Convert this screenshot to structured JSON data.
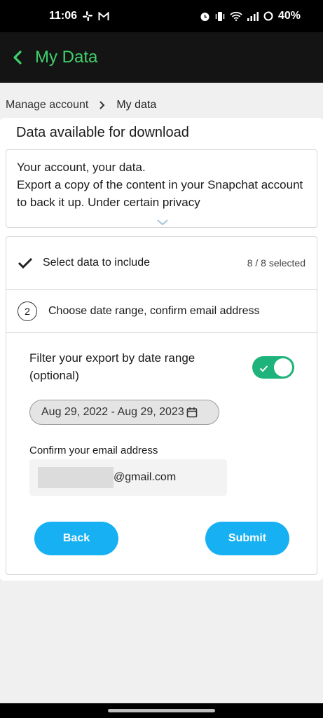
{
  "status_bar": {
    "time": "11:06",
    "battery": "40%",
    "left_icons": [
      "slack-icon",
      "mail-icon"
    ],
    "right_icons": [
      "alarm-icon",
      "vibrate-icon",
      "wifi-icon",
      "signal-icon",
      "battery-icon"
    ]
  },
  "app_bar": {
    "title": "My Data",
    "accent_color": "#3fd06a"
  },
  "breadcrumb": {
    "parent": "Manage account",
    "current": "My data"
  },
  "card": {
    "title": "Data available for download",
    "intro": {
      "line1": "Your account, your data.",
      "line2": "Export a copy of the content in your Snapchat account to back it up. Under certain privacy"
    }
  },
  "steps": {
    "step1": {
      "label": "Select data to include",
      "count": "8 / 8 selected"
    },
    "step2": {
      "number": "2",
      "label": "Choose date range, confirm email address"
    }
  },
  "filter": {
    "label": "Filter your export by date range (optional)",
    "enabled": true,
    "date_range": "Aug 29, 2022 - Aug 29, 2023"
  },
  "email": {
    "label": "Confirm your email address",
    "value": "@gmail.com"
  },
  "buttons": {
    "back": "Back",
    "submit": "Submit",
    "color": "#17b0f2"
  }
}
